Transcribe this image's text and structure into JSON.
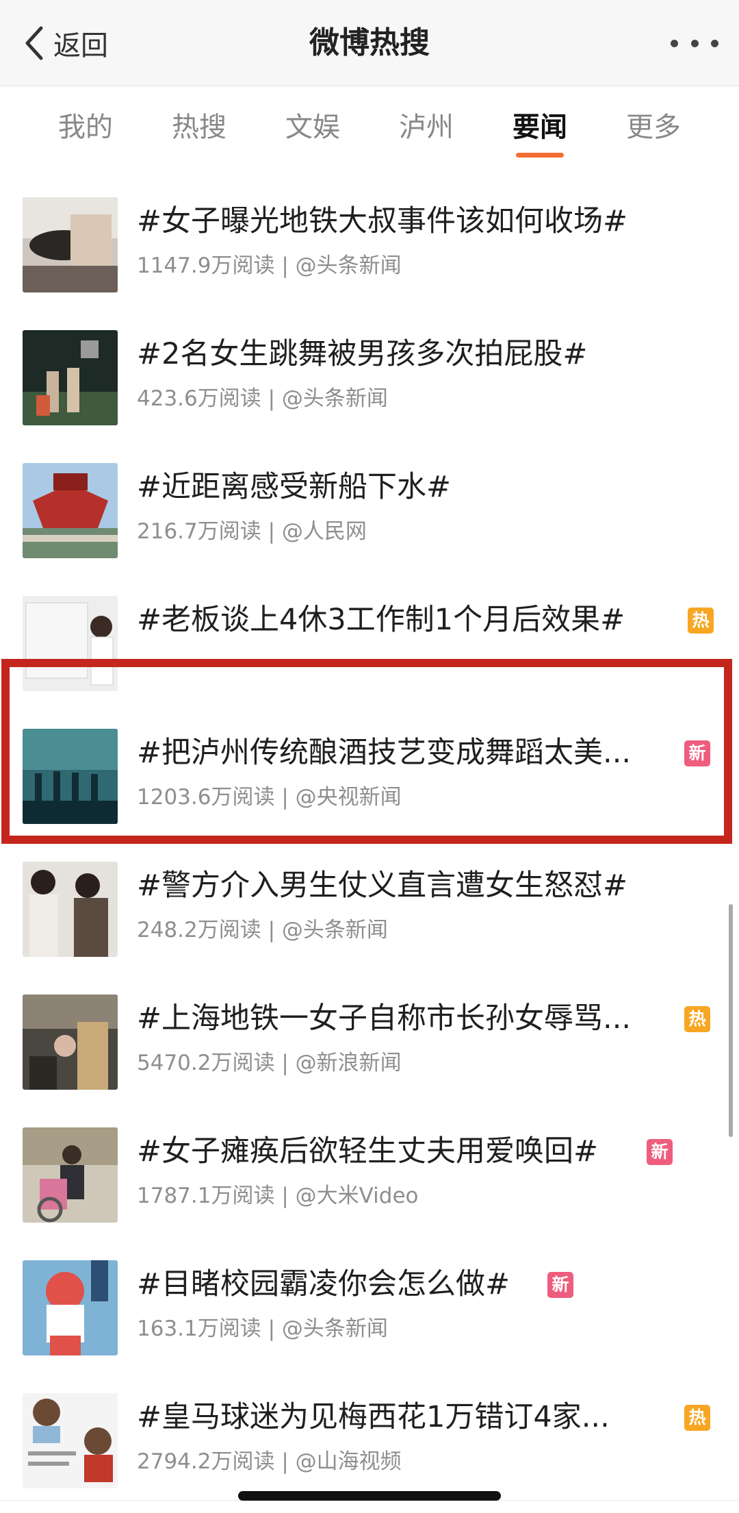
{
  "header": {
    "back_label": "返回",
    "title": "微博热搜"
  },
  "tabs": [
    {
      "label": "我的",
      "active": false
    },
    {
      "label": "热搜",
      "active": false
    },
    {
      "label": "文娱",
      "active": false
    },
    {
      "label": "泸州",
      "active": false
    },
    {
      "label": "要闻",
      "active": true
    },
    {
      "label": "更多",
      "active": false
    }
  ],
  "items": [
    {
      "title": "#女子曝光地铁大叔事件该如何收场#",
      "reads": "1147.9万阅读",
      "source": "@头条新闻",
      "badge": ""
    },
    {
      "title": "#2名女生跳舞被男孩多次拍屁股#",
      "reads": "423.6万阅读",
      "source": "@头条新闻",
      "badge": ""
    },
    {
      "title": "#近距离感受新船下水#",
      "reads": "216.7万阅读",
      "source": "@人民网",
      "badge": ""
    },
    {
      "title": "#老板谈上4休3工作制1个月后效果#",
      "reads": "",
      "source": "",
      "badge": "热"
    },
    {
      "title": "#把泸州传统酿酒技艺变成舞蹈太美...",
      "reads": "1203.6万阅读",
      "source": "@央视新闻",
      "badge": "新"
    },
    {
      "title": "#警方介入男生仗义直言遭女生怒怼#",
      "reads": "248.2万阅读",
      "source": "@头条新闻",
      "badge": ""
    },
    {
      "title": "#上海地铁一女子自称市长孙女辱骂...",
      "reads": "5470.2万阅读",
      "source": "@新浪新闻",
      "badge": "热"
    },
    {
      "title": "#女子瘫痪后欲轻生丈夫用爱唤回#",
      "reads": "1787.1万阅读",
      "source": "@大米Video",
      "badge": "新"
    },
    {
      "title": "#目睹校园霸凌你会怎么做#",
      "reads": "163.1万阅读",
      "source": "@头条新闻",
      "badge": "新"
    },
    {
      "title": "#皇马球迷为见梅西花1万错订4家...",
      "reads": "2794.2万阅读",
      "source": "@山海视频",
      "badge": "热"
    }
  ],
  "colors": {
    "tab_accent": "#f26e31",
    "hot_badge": "#f7a623",
    "new_badge": "#ef5d7e",
    "highlight_border": "#c4251c"
  },
  "icons": [
    "chevron-left-icon",
    "more-dots-icon"
  ]
}
